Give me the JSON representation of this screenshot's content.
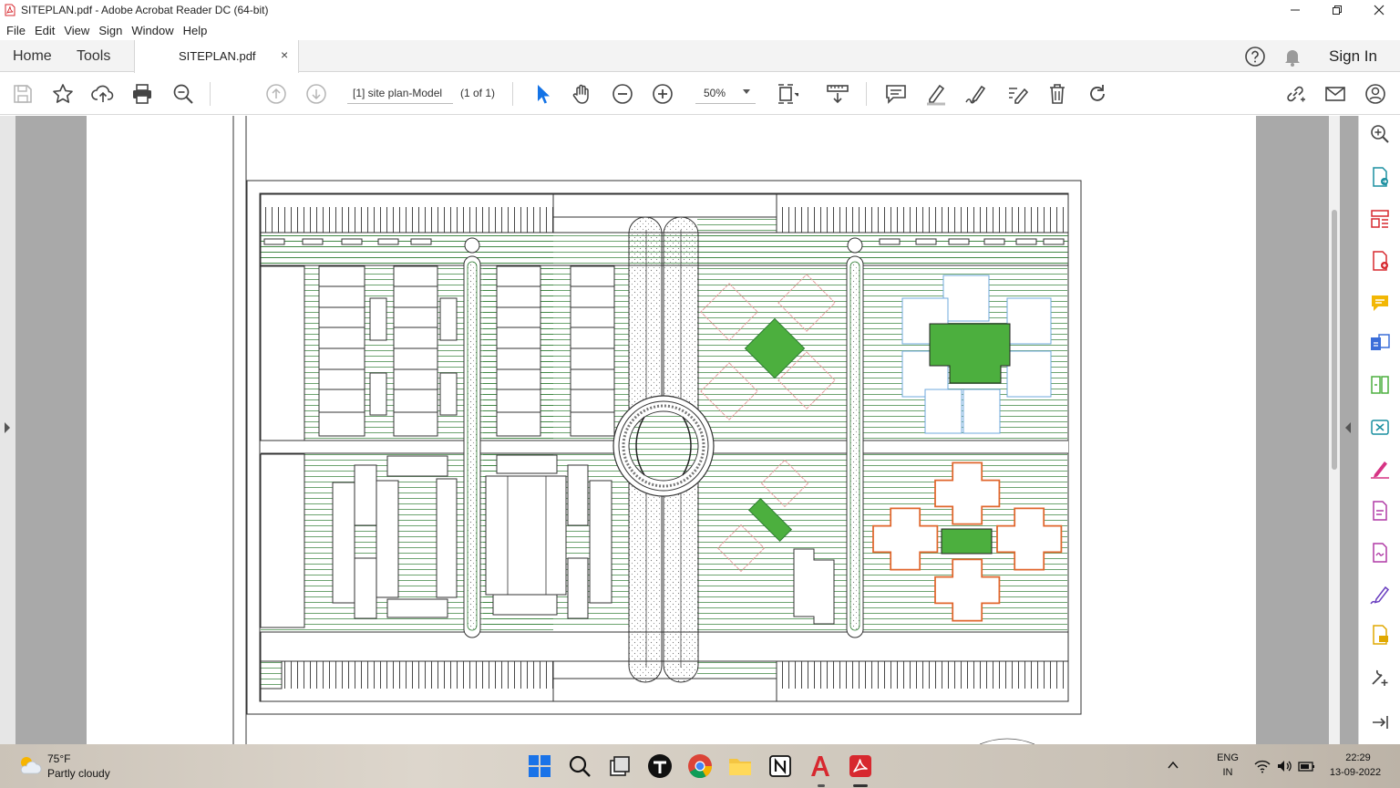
{
  "window": {
    "title": "SITEPLAN.pdf - Adobe Acrobat Reader DC (64-bit)"
  },
  "menu": {
    "items": [
      "File",
      "Edit",
      "View",
      "Sign",
      "Window",
      "Help"
    ]
  },
  "tabs": {
    "home": "Home",
    "tools": "Tools",
    "document": "SITEPLAN.pdf",
    "close_symbol": "×",
    "sign_in": "Sign In"
  },
  "toolbar": {
    "page_label": "[1] site plan-Model",
    "page_count": "(1 of 1)",
    "zoom": "50%"
  },
  "taskbar": {
    "temperature": "75°F",
    "weather": "Partly cloudy",
    "language": "ENG",
    "region": "IN",
    "time": "22:29",
    "date": "13-09-2022"
  },
  "colors": {
    "acrobat_red": "#d7282f",
    "accent_blue": "#1473e6",
    "plan_green": "#4caf3e",
    "hatch_green": "#2e7d32",
    "orange_outline": "#e0662c",
    "pink_outline": "#e39a9a",
    "blue_outline": "#6fa8dc"
  }
}
